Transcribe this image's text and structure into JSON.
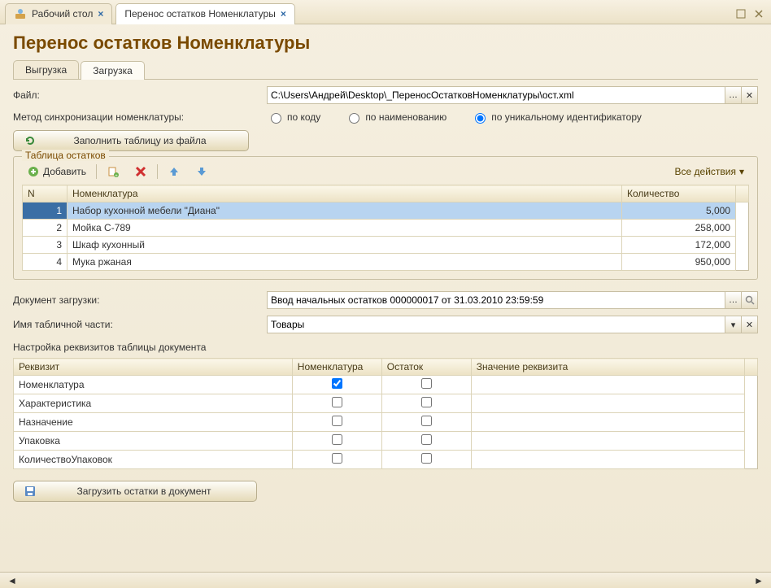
{
  "app_tabs": [
    {
      "label": "Рабочий стол"
    },
    {
      "label": "Перенос остатков Номенклатуры"
    }
  ],
  "title": "Перенос остатков Номенклатуры",
  "sub_tabs": [
    {
      "label": "Выгрузка"
    },
    {
      "label": "Загрузка"
    }
  ],
  "file_label": "Файл:",
  "file_value": "С:\\Users\\Андрей\\Desktop\\_ПереносОстатковНоменклатуры\\ост.xml",
  "sync_label": "Метод синхронизации номенклатуры:",
  "sync_options": {
    "by_code": "по коду",
    "by_name": "по наименованию",
    "by_uid": "по уникальному идентификатору"
  },
  "fill_button": "Заполнить таблицу из файла",
  "table_legend": "Таблица остатков",
  "toolbar": {
    "add": "Добавить",
    "all_actions": "Все действия"
  },
  "grid": {
    "headers": {
      "n": "N",
      "nomen": "Номенклатура",
      "qty": "Количество"
    },
    "rows": [
      {
        "n": "1",
        "nomen": "Набор кухонной мебели \"Диана\"",
        "qty": "5,000"
      },
      {
        "n": "2",
        "nomen": "Мойка С-789",
        "qty": "258,000"
      },
      {
        "n": "3",
        "nomen": "Шкаф кухонный",
        "qty": "172,000"
      },
      {
        "n": "4",
        "nomen": "Мука ржаная",
        "qty": "950,000"
      }
    ]
  },
  "doc_label": "Документ загрузки:",
  "doc_value": "Ввод начальных остатков 000000017 от 31.03.2010 23:59:59",
  "tabpart_label": "Имя табличной части:",
  "tabpart_value": "Товары",
  "req_label": "Настройка реквизитов таблицы документа",
  "req": {
    "headers": {
      "req": "Реквизит",
      "nomen": "Номенклатура",
      "rest": "Остаток",
      "val": "Значение реквизита"
    },
    "rows": [
      {
        "req": "Номенклатура",
        "nomen": true,
        "rest": false
      },
      {
        "req": "Характеристика",
        "nomen": false,
        "rest": false
      },
      {
        "req": "Назначение",
        "nomen": false,
        "rest": false
      },
      {
        "req": "Упаковка",
        "nomen": false,
        "rest": false
      },
      {
        "req": "КоличествоУпаковок",
        "nomen": false,
        "rest": false
      }
    ]
  },
  "load_button": "Загрузить остатки в документ"
}
